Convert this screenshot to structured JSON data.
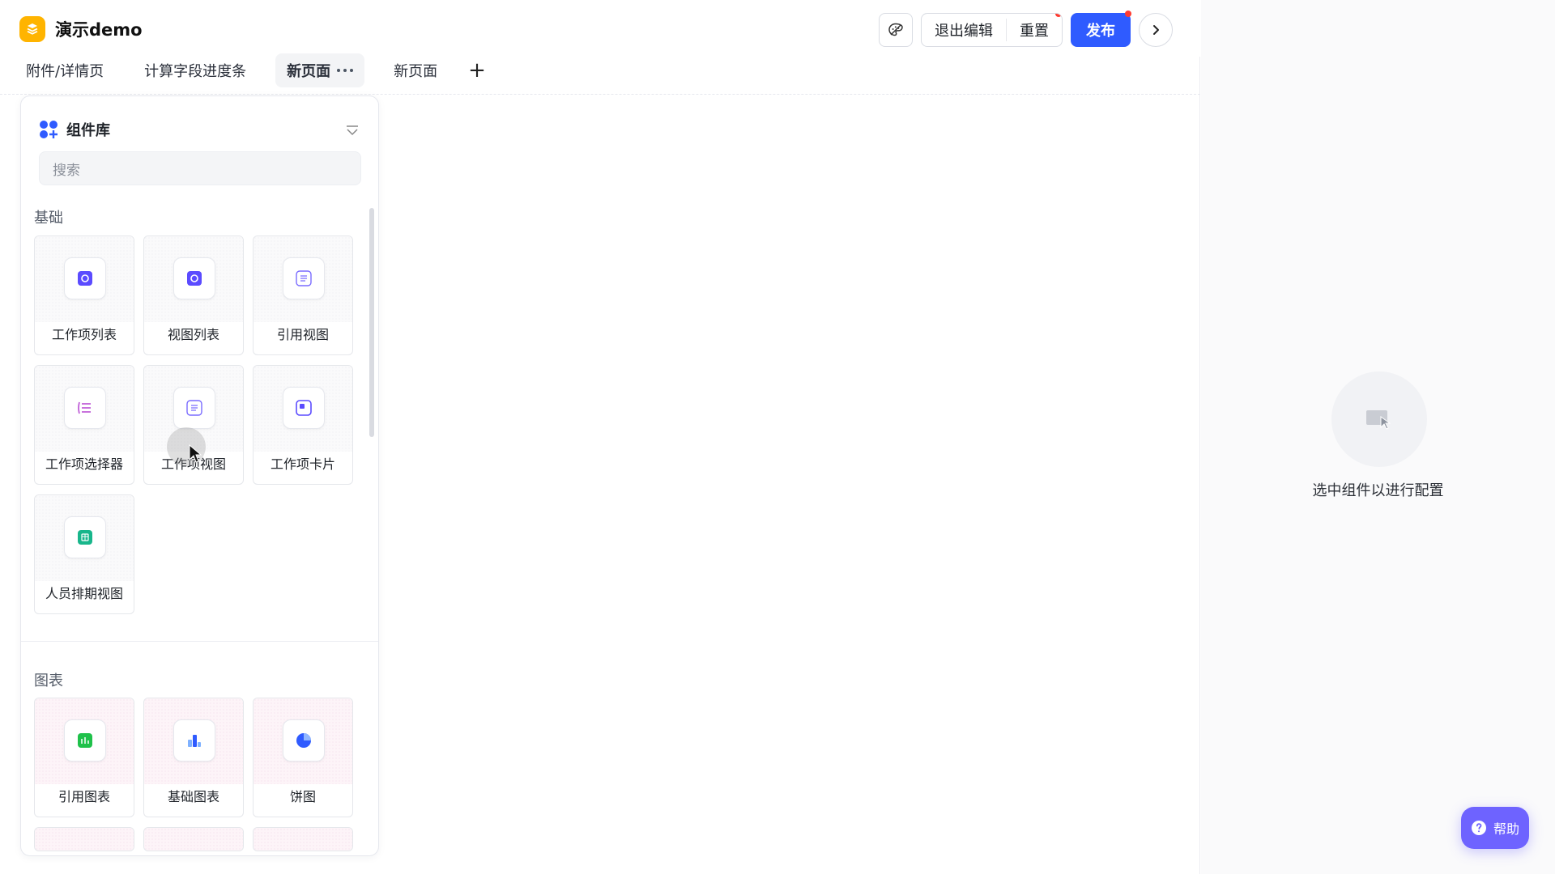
{
  "app": {
    "name": "演示demo"
  },
  "header": {
    "exit_edit": "退出编辑",
    "reset": "重置",
    "publish": "发布"
  },
  "tabs": [
    {
      "label": "附件/详情页"
    },
    {
      "label": "计算字段进度条"
    },
    {
      "label": "新页面"
    },
    {
      "label": "新页面"
    }
  ],
  "library": {
    "title": "组件库",
    "search_placeholder": "搜索",
    "sections": [
      {
        "title": "基础",
        "items": [
          {
            "label": "工作项列表",
            "icon": "list-icon"
          },
          {
            "label": "视图列表",
            "icon": "view-list-icon"
          },
          {
            "label": "引用视图",
            "icon": "reference-view-icon"
          },
          {
            "label": "工作项选择器",
            "icon": "selector-icon"
          },
          {
            "label": "工作项视图",
            "icon": "view-icon"
          },
          {
            "label": "工作项卡片",
            "icon": "card-icon"
          },
          {
            "label": "人员排期视图",
            "icon": "schedule-icon"
          }
        ]
      },
      {
        "title": "图表",
        "items": [
          {
            "label": "引用图表",
            "icon": "reference-chart-icon"
          },
          {
            "label": "基础图表",
            "icon": "bar-chart-icon"
          },
          {
            "label": "饼图",
            "icon": "pie-chart-icon"
          }
        ]
      }
    ]
  },
  "config": {
    "empty_text": "选中组件以进行配置"
  },
  "help": {
    "label": "帮助"
  },
  "colors": {
    "brand": "#2f5bff",
    "logo": "#ffb400",
    "help": "#6e63ff"
  }
}
